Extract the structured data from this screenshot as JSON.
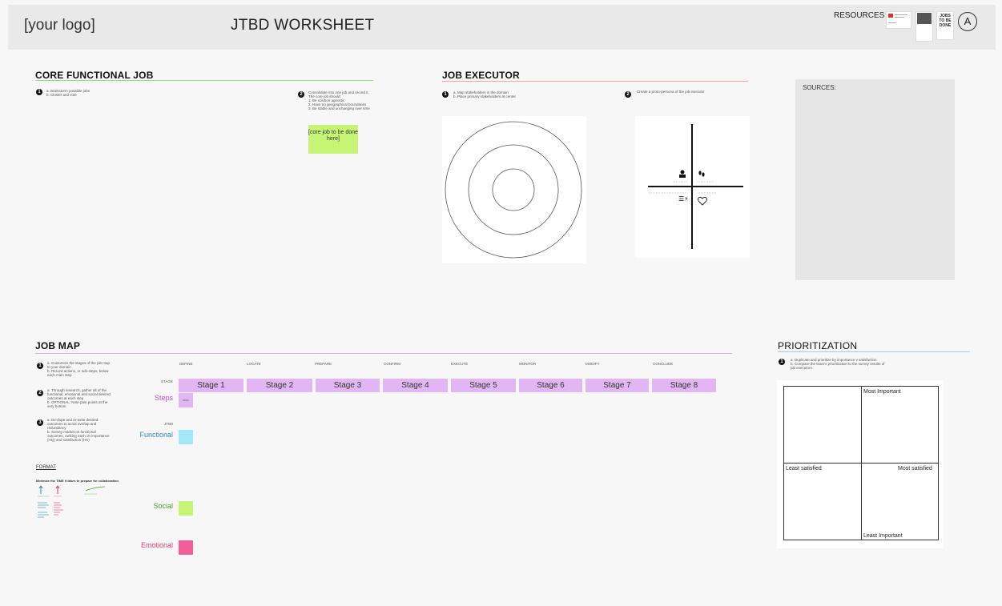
{
  "header": {
    "logo": "[your logo]",
    "title": "JTBD WORKSHEET",
    "resources_label": "RESOURCES",
    "book_thumb": "JOBS TO BE DONE",
    "logo_icon": "A"
  },
  "core": {
    "title": "CORE FUNCTIONAL JOB",
    "step1": "a. Brainstorm possible jobs\nb. Cluster and vote",
    "step2": "Consolidate into one job and record it.\nThe core job should:\n1. Be solution agnostic\n2. Have no geographical boundaries\n3. Be stable and unchanging over time",
    "sticky": "[core job to be done here]"
  },
  "executor": {
    "title": "JOB EXECUTOR",
    "step1": "a. Map stakeholders in the domain\nb. Place primary stakeholders at center",
    "step2": "Create a proto-persona of the job executor"
  },
  "sources": {
    "label": "SOURCES:"
  },
  "jobmap": {
    "title": "JOB MAP",
    "step1": "a. Customize the stages of the job map to your domain\nb. Record actions, or sub-steps, below each main step",
    "step2": "a. Through research, gather all of the functional, emotional and social desired outcomes at each step\nb. OPTIONAL: Note pain points at the very bottom",
    "step3": "a. De-dupe and re-write desired outcomes to avoid overlap and redundancy\nb. Survey market on functional outcomes, ranking each on importance (HQ) and satisfaction (HS)",
    "format_label": "FORMAT",
    "format_note": "Minimize the TIME it takes to prepare for collaboration",
    "stage_row_label": "STAGE",
    "jtbd_label": "JTBD",
    "stage_headers": [
      "DEFINE",
      "LOCATE",
      "PREPARE",
      "CONFIRM",
      "EXECUTE",
      "MONITOR",
      "MODIFY",
      "CONCLUDE"
    ],
    "stages": [
      "Stage 1",
      "Stage 2",
      "Stage 3",
      "Stage 4",
      "Stage 5",
      "Stage 6",
      "Stage 7",
      "Stage 8"
    ],
    "rows": {
      "steps": "Steps",
      "functional": "Functional",
      "social": "Social",
      "emotional": "Emotional"
    },
    "colors": {
      "steps": "#c04fc9",
      "functional": "#2c8bbd",
      "social": "#4a9a2a",
      "emotional": "#e23c7a",
      "steps_sq": "#e1b6f3",
      "functional_sq": "#a3e8f8",
      "social_sq": "#c6f576",
      "emotional_sq": "#f25d9c"
    },
    "step_sticky": "step"
  },
  "prioritization": {
    "title": "PRIORITIZATION",
    "step1": "a. Duplicate and prioritize by importance v satisfaction\nb. Compare the team's prioritization to the survey results of job executors",
    "most_important": "Most Important",
    "least_important": "Least Important",
    "least_satisfied": "Least satisfied",
    "most_satisfied": "Most satisfied"
  }
}
